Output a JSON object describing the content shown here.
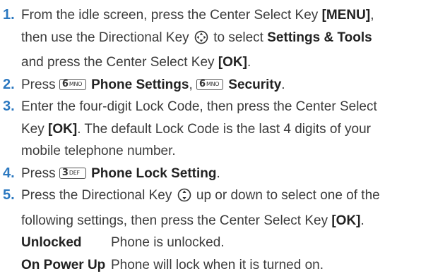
{
  "steps": [
    {
      "num": "1.",
      "lines": [
        {
          "t1": "From the idle screen, press the Center Select Key ",
          "b1": "[MENU]",
          "t2": ","
        },
        {
          "t1": "then use the Directional Key ",
          "t2": " to select ",
          "b1": "Settings & Tools"
        },
        {
          "t1": "and press the Center Select Key ",
          "b1": "[OK]",
          "t2": "."
        }
      ]
    },
    {
      "num": "2.",
      "pre": "Press ",
      "key1": {
        "n": "6",
        "l": "MNO"
      },
      "b1": " Phone Settings",
      "mid": ", ",
      "key2": {
        "n": "6",
        "l": "MNO"
      },
      "b2": " Security",
      "post": "."
    },
    {
      "num": "3.",
      "lines": [
        "Enter the four-digit Lock Code, then press the Center Select",
        {
          "pre": "Key ",
          "b": "[OK]",
          "post": ". The default Lock Code is the last 4 digits of your"
        },
        "mobile telephone number."
      ]
    },
    {
      "num": "4.",
      "pre": "Press ",
      "key": {
        "n": "3",
        "l": "DEF"
      },
      "b": " Phone Lock Setting",
      "post": "."
    },
    {
      "num": "5.",
      "line1a": "Press the Directional Key ",
      "line1b": " up or down to select one of the",
      "line2a": "following settings, then press the Center Select Key ",
      "line2b": "[OK]",
      "line2c": ".",
      "settings": [
        {
          "name": "Unlocked",
          "desc": "Phone is unlocked."
        },
        {
          "name": "On Power Up",
          "desc": "Phone will lock when it is turned on."
        }
      ]
    }
  ],
  "colors": {
    "step_number": "#2b78c0",
    "text": "#3b3b3b"
  },
  "icons": {
    "four_way": "directional-key-four-way-icon",
    "up_down": "directional-key-up-down-icon"
  }
}
